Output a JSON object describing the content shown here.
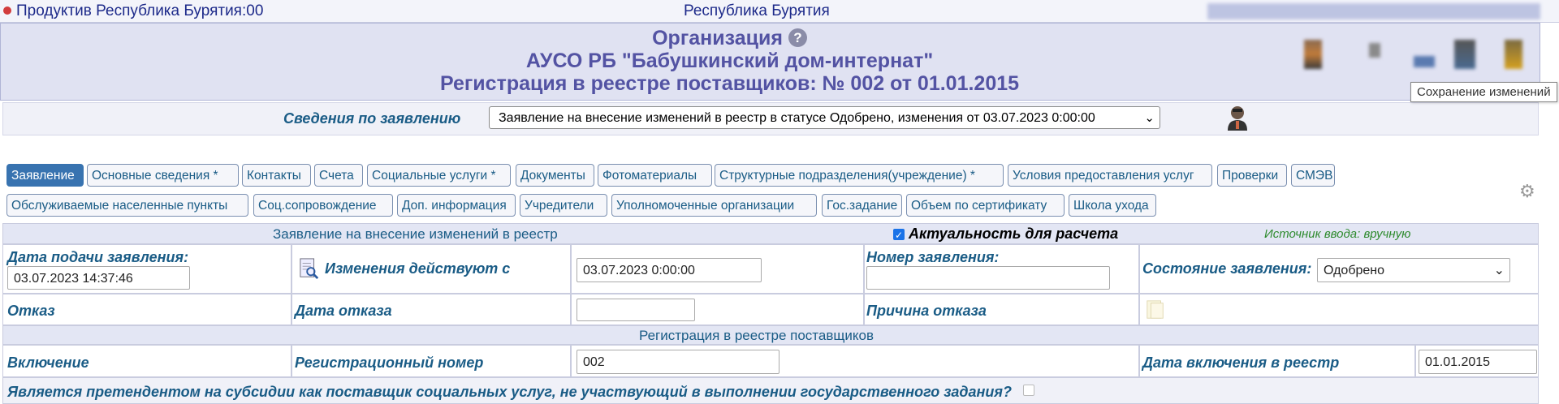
{
  "topbar": {
    "title": "Продуктив Республика Бурятия:00",
    "center": "Республика Бурятия"
  },
  "header": {
    "line1": "Организация",
    "line2": "АУСО РБ \"Бабушкинский дом-интернат\"",
    "line3": "Регистрация в реестре поставщиков: № 002 от 01.01.2015",
    "help_glyph": "?",
    "tooltip": "Сохранение изменений"
  },
  "svedeniya": {
    "label": "Сведения по заявлению",
    "selected": "Заявление на внесение изменений в реестр в статусе Одобрено, изменения от 03.07.2023 0:00:00"
  },
  "tabs_row1": [
    "Заявление",
    "Основные сведения *",
    "Контакты",
    "Счета",
    "Социальные услуги *",
    "Документы",
    "Фотоматериалы",
    "Структурные подразделения(учреждение) *",
    "Условия предоставления услуг",
    "Проверки",
    "СМЭВ"
  ],
  "tabs_row2": [
    "Обслуживаемые населенные пункты",
    "Соц.сопровождение",
    "Доп. информация",
    "Учредители",
    "Уполномоченные организации",
    "Гос.задание",
    "Объем по сертификату",
    "Школа ухода"
  ],
  "form": {
    "section_title": "Заявление на внесение изменений в реестр",
    "actuality_label": "Актуальность для расчета",
    "source": "Источник ввода: вручную",
    "date_submit_label": "Дата подачи заявления:",
    "date_submit_value": "03.07.2023 14:37:46",
    "changes_label": "Изменения действуют с",
    "changes_value": "03.07.2023 0:00:00",
    "number_label": "Номер заявления:",
    "number_value": "",
    "state_label": "Состояние заявления:",
    "state_value": "Одобрено",
    "refusal_label": "Отказ",
    "refusal_date_label": "Дата отказа",
    "refusal_date_value": "",
    "refusal_reason_label": "Причина отказа",
    "reg_title": "Регистрация в реестре поставщиков",
    "inclusion_label": "Включение",
    "reg_number_label": "Регистрационный номер",
    "reg_number_value": "002",
    "reg_date_label": "Дата включения в реестр",
    "reg_date_value": "01.01.2015",
    "subsidy_label": "Является претендентом на субсидии как поставщик социальных услуг, не участвующий в выполнении государственного задания?"
  },
  "colors": {
    "accent": "#3873b0",
    "label": "#1a5c86",
    "header": "#5353a3",
    "source": "#2e8b2e"
  }
}
